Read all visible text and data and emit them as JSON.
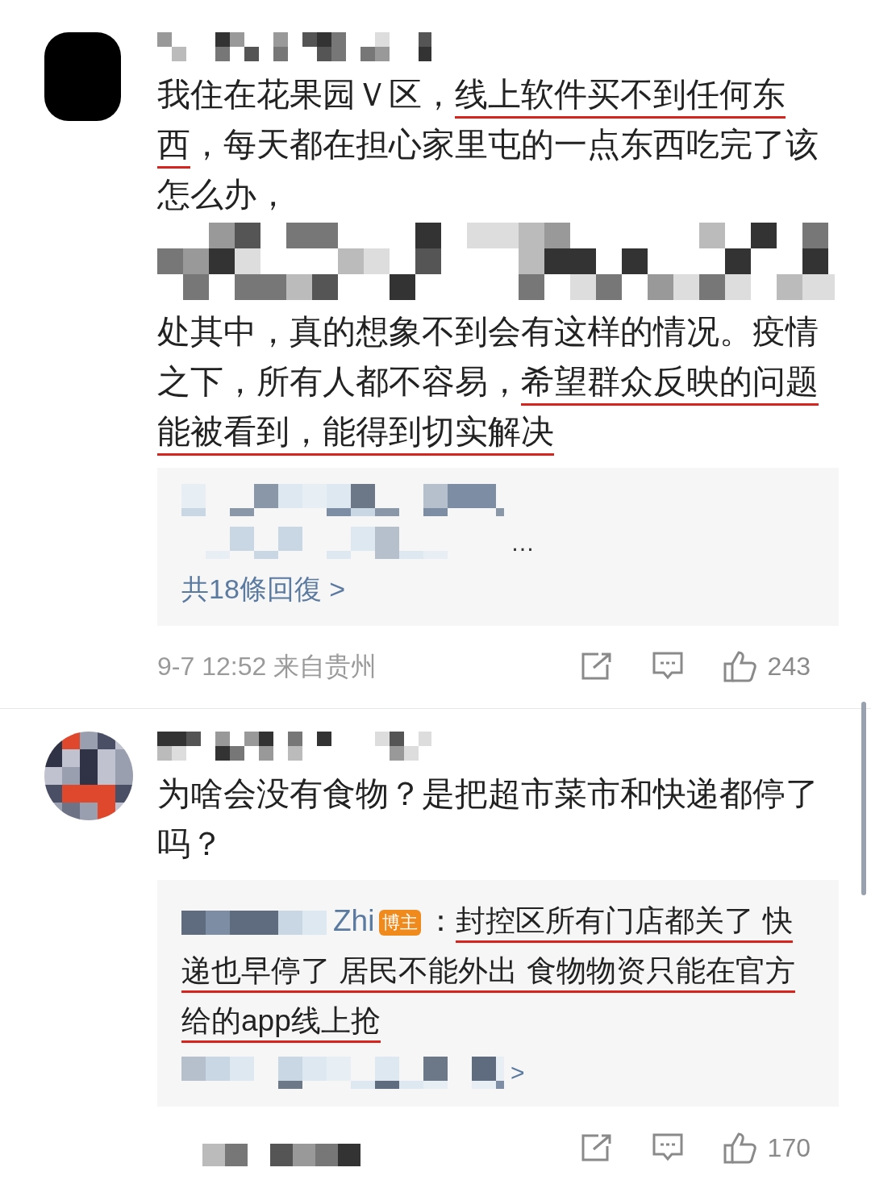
{
  "comments": [
    {
      "avatar": {
        "kind": "dark"
      },
      "body": [
        {
          "kind": "text",
          "segments": [
            {
              "text": "我住在花果园Ｖ区，",
              "underlined": false
            },
            {
              "text": "线上软件买不到任何东西",
              "underlined": true
            },
            {
              "text": "，每天都在担心家里屯的一点东西吃完了该怎么办，",
              "underlined": false
            }
          ]
        },
        {
          "kind": "pixelated"
        },
        {
          "kind": "text",
          "segments": [
            {
              "text": "处其中，真的想象不到会有这样的情况。疫情之下，所有人都不容易，",
              "underlined": false
            },
            {
              "text": "希望群众反映的问题能被看到，能得到切实解决",
              "underlined": true
            }
          ]
        }
      ],
      "replies": [
        {
          "kind": "pixelated"
        },
        {
          "kind": "pixelated",
          "trailing": "…"
        },
        {
          "kind": "link",
          "text": "共18條回復 >"
        }
      ],
      "time": "9-7 12:52 来自贵州",
      "likes": "243"
    },
    {
      "avatar": {
        "kind": "mosaic"
      },
      "body": [
        {
          "kind": "text",
          "segments": [
            {
              "text": "为啥会没有食物？是把超市菜市和快递都停了吗？",
              "underlined": false
            }
          ]
        }
      ],
      "replies": [
        {
          "kind": "reply",
          "author": "Zhi",
          "badge": "博主",
          "separator": "：",
          "segments": [
            {
              "text": "封控区所有门店都关了 快递也早停了 居民不能外出 食物物资只能在官方给的app线上抢",
              "underlined": true
            }
          ]
        },
        {
          "kind": "pixelated",
          "trailing": ">"
        }
      ],
      "likes": "170"
    }
  ]
}
